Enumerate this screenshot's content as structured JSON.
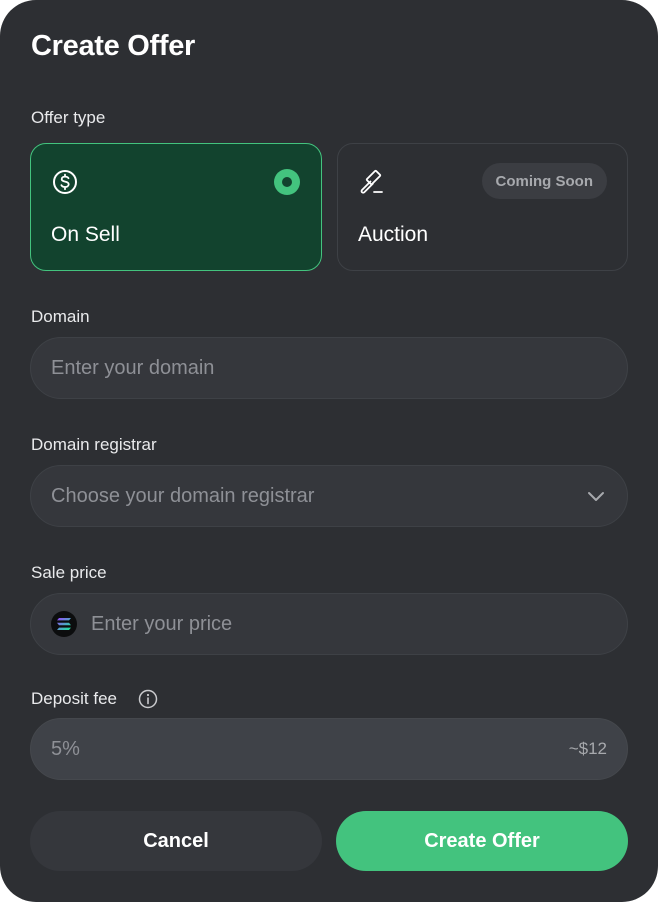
{
  "dialog": {
    "title": "Create Offer"
  },
  "offer_type": {
    "label": "Offer type",
    "options": [
      {
        "name": "On Sell",
        "icon": "dollar-circle-icon",
        "selected": true
      },
      {
        "name": "Auction",
        "icon": "gavel-icon",
        "badge": "Coming Soon",
        "selected": false
      }
    ]
  },
  "domain": {
    "label": "Domain",
    "placeholder": "Enter your domain"
  },
  "registrar": {
    "label": "Domain registrar",
    "placeholder": "Choose your domain registrar",
    "icon": "chevron-down-icon"
  },
  "sale_price": {
    "label": "Sale price",
    "placeholder": "Enter your price",
    "icon": "solana-icon"
  },
  "deposit_fee": {
    "label": "Deposit fee",
    "icon": "info-icon",
    "value": "5%",
    "estimate": "~$12"
  },
  "actions": {
    "cancel_label": "Cancel",
    "create_label": "Create Offer"
  },
  "colors": {
    "background": "#2d2f33",
    "accent": "#43c37e",
    "selected_card": "#12432e"
  }
}
